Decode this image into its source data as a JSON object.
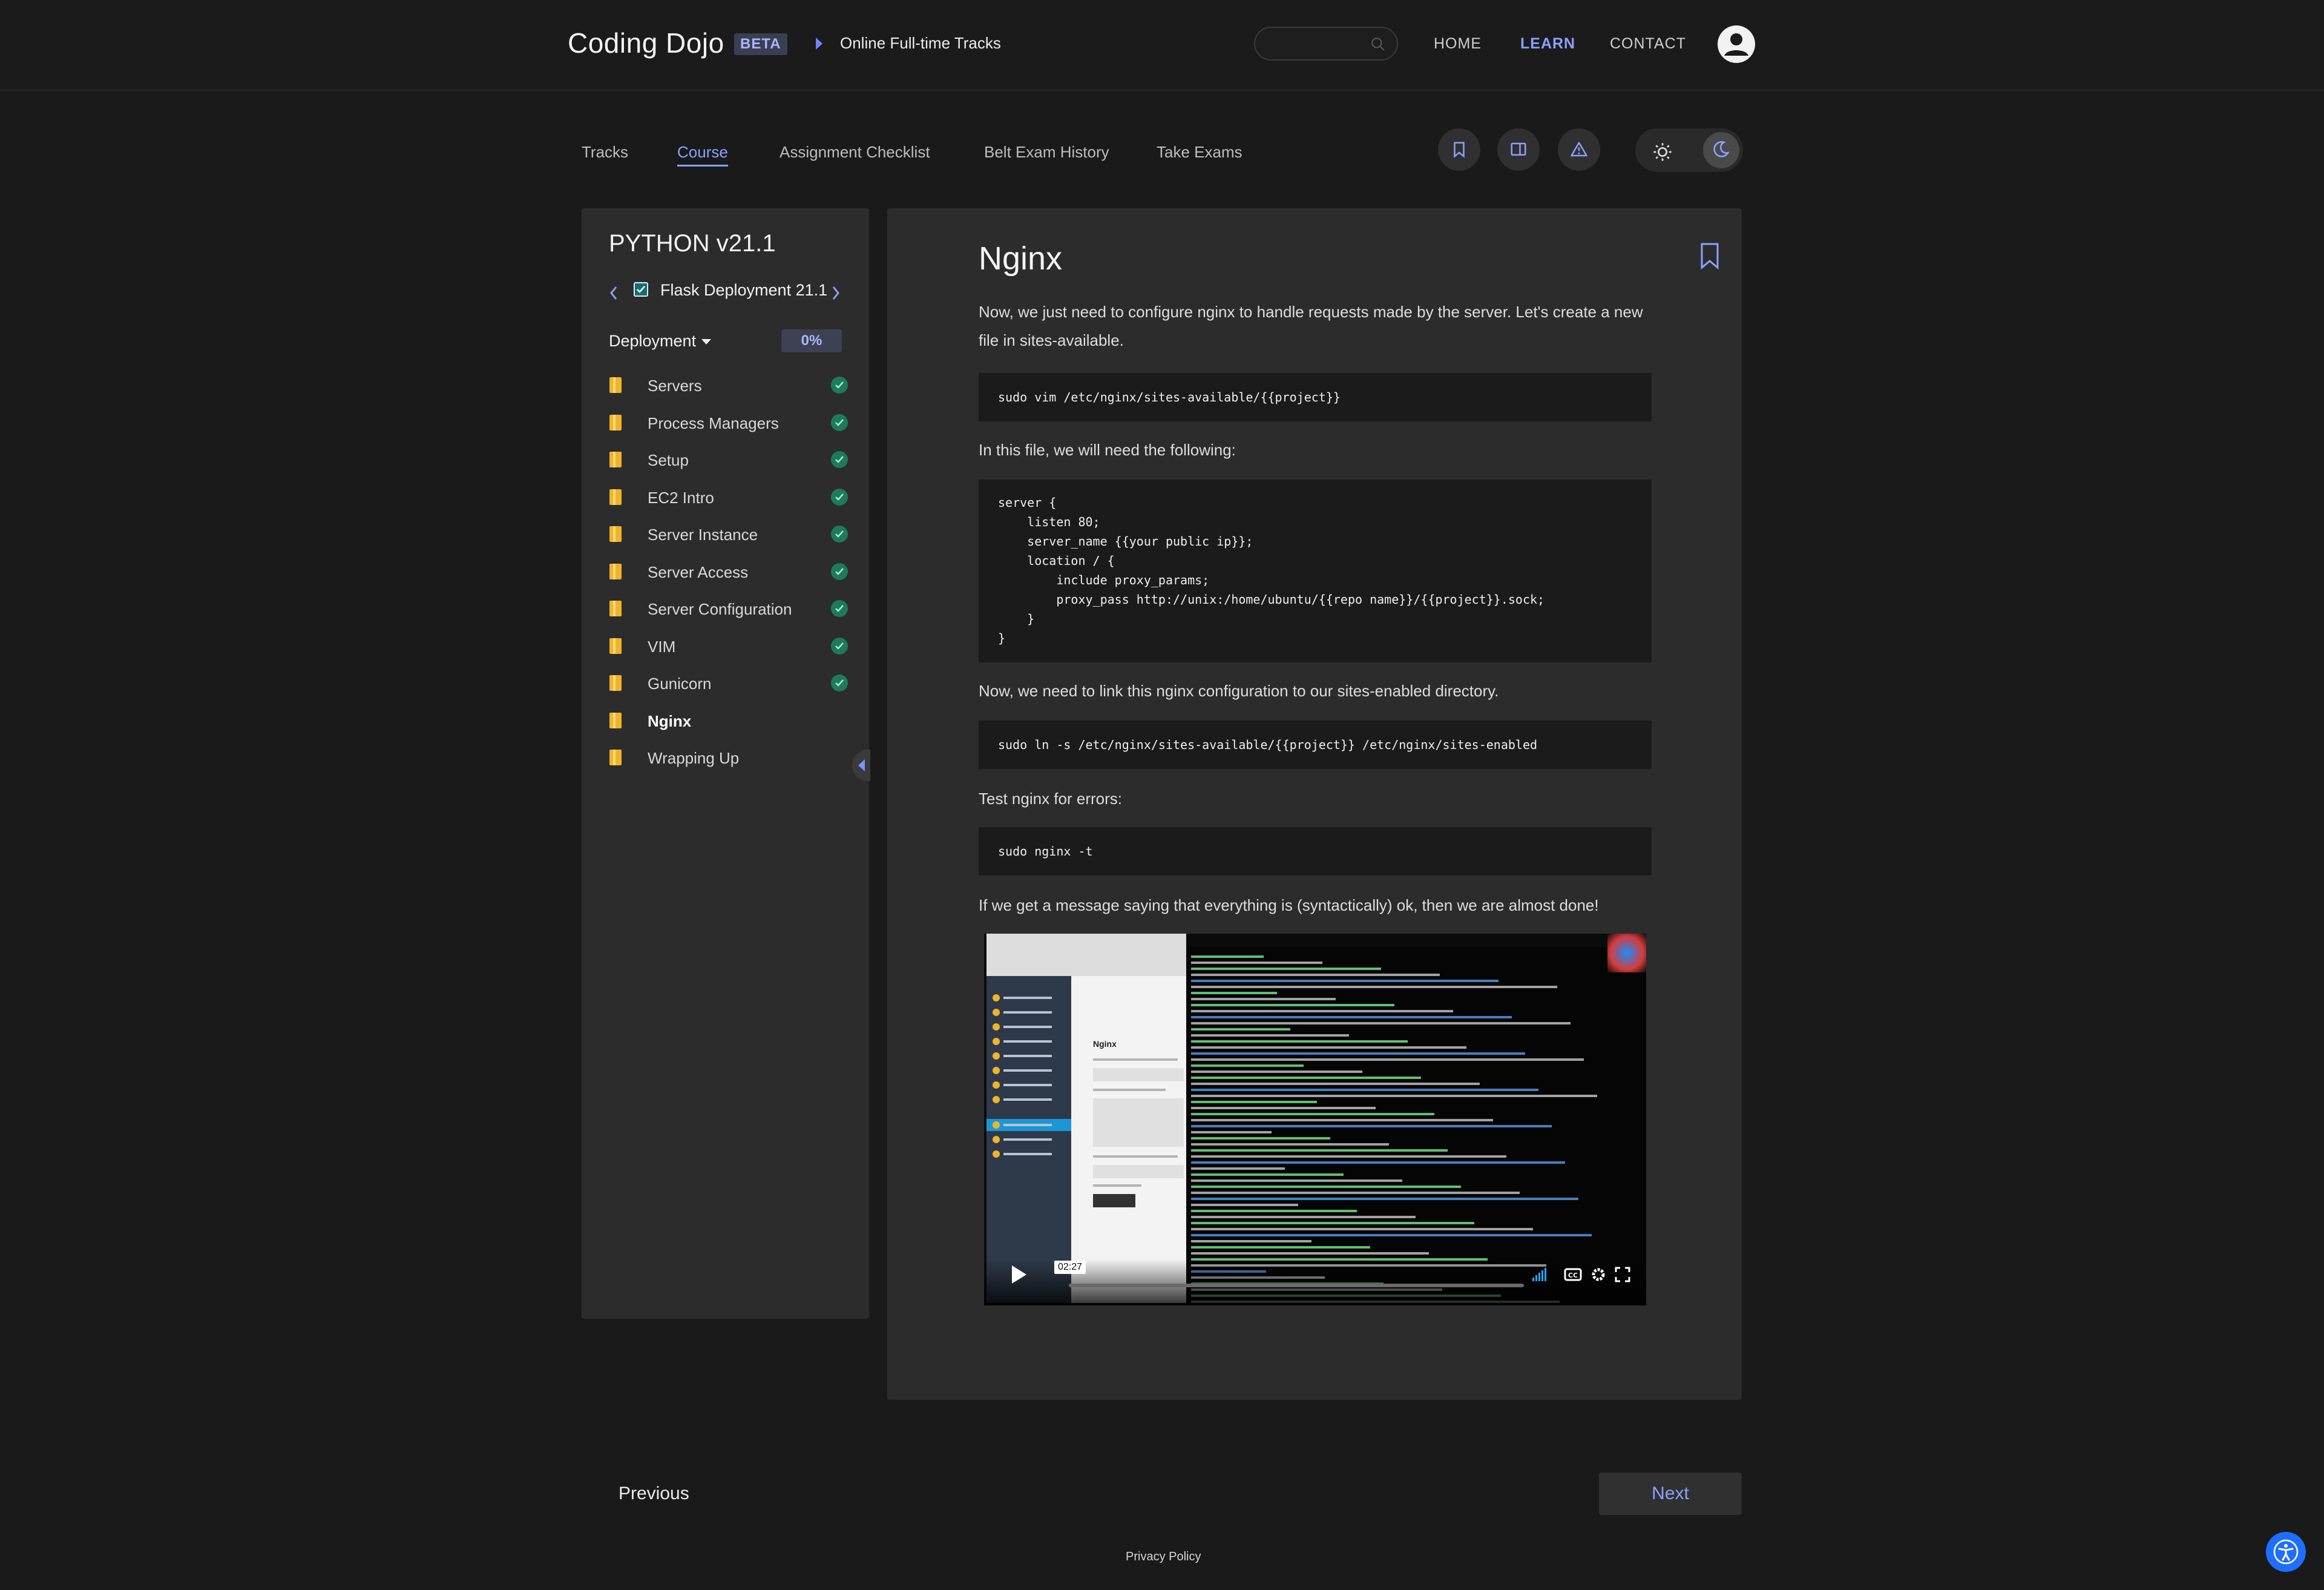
{
  "header": {
    "logo": "Coding Dojo",
    "badge": "BETA",
    "breadcrumb": "Online Full-time Tracks",
    "search_placeholder": "",
    "nav": {
      "home": "HOME",
      "learn": "LEARN",
      "contact": "CONTACT"
    }
  },
  "subnav": {
    "tracks": "Tracks",
    "course": "Course",
    "assignment_checklist": "Assignment Checklist",
    "belt_exam_history": "Belt Exam History",
    "take_exams": "Take Exams"
  },
  "sidebar": {
    "course_title": "PYTHON v21.1",
    "module_name": "Flask Deployment 21.1",
    "section": "Deployment",
    "progress": "0%",
    "lessons": [
      {
        "label": "Servers",
        "done": true
      },
      {
        "label": "Process Managers",
        "done": true
      },
      {
        "label": "Setup",
        "done": true
      },
      {
        "label": "EC2 Intro",
        "done": true
      },
      {
        "label": "Server Instance",
        "done": true
      },
      {
        "label": "Server Access",
        "done": true
      },
      {
        "label": "Server Configuration",
        "done": true
      },
      {
        "label": "VIM",
        "done": true
      },
      {
        "label": "Gunicorn",
        "done": true
      },
      {
        "label": "Nginx",
        "done": false,
        "current": true
      },
      {
        "label": "Wrapping Up",
        "done": false
      }
    ]
  },
  "content": {
    "title": "Nginx",
    "p1": "Now, we just need to configure nginx to handle requests made by the server. Let's create a new file in sites-available.",
    "code1": "sudo vim /etc/nginx/sites-available/{{project}}",
    "p2": "In this file, we will need the following:",
    "code2": "server {\n    listen 80;\n    server_name {{your public ip}};\n    location / {\n        include proxy_params;\n        proxy_pass http://unix:/home/ubuntu/{{repo name}}/{{project}}.sock;\n    }\n}",
    "p3": "Now, we need to link this nginx configuration to our sites-enabled directory.",
    "code3": "sudo ln -s /etc/nginx/sites-available/{{project}} /etc/nginx/sites-enabled",
    "p4": "Test nginx for errors:",
    "code4": "sudo nginx -t",
    "p5": "If we get a message saying that everything is (syntactically) ok, then we are almost done!",
    "video": {
      "timecode": "02:27",
      "inner_title": "Nginx"
    }
  },
  "footer": {
    "previous": "Previous",
    "next": "Next",
    "privacy": "Privacy Policy"
  },
  "colors": {
    "background": "#1a1a1a",
    "panel": "#2c2c2c",
    "accent": "#8aa2ff",
    "done_check": "#1f7a5c",
    "book_icon": "#f0b429"
  }
}
